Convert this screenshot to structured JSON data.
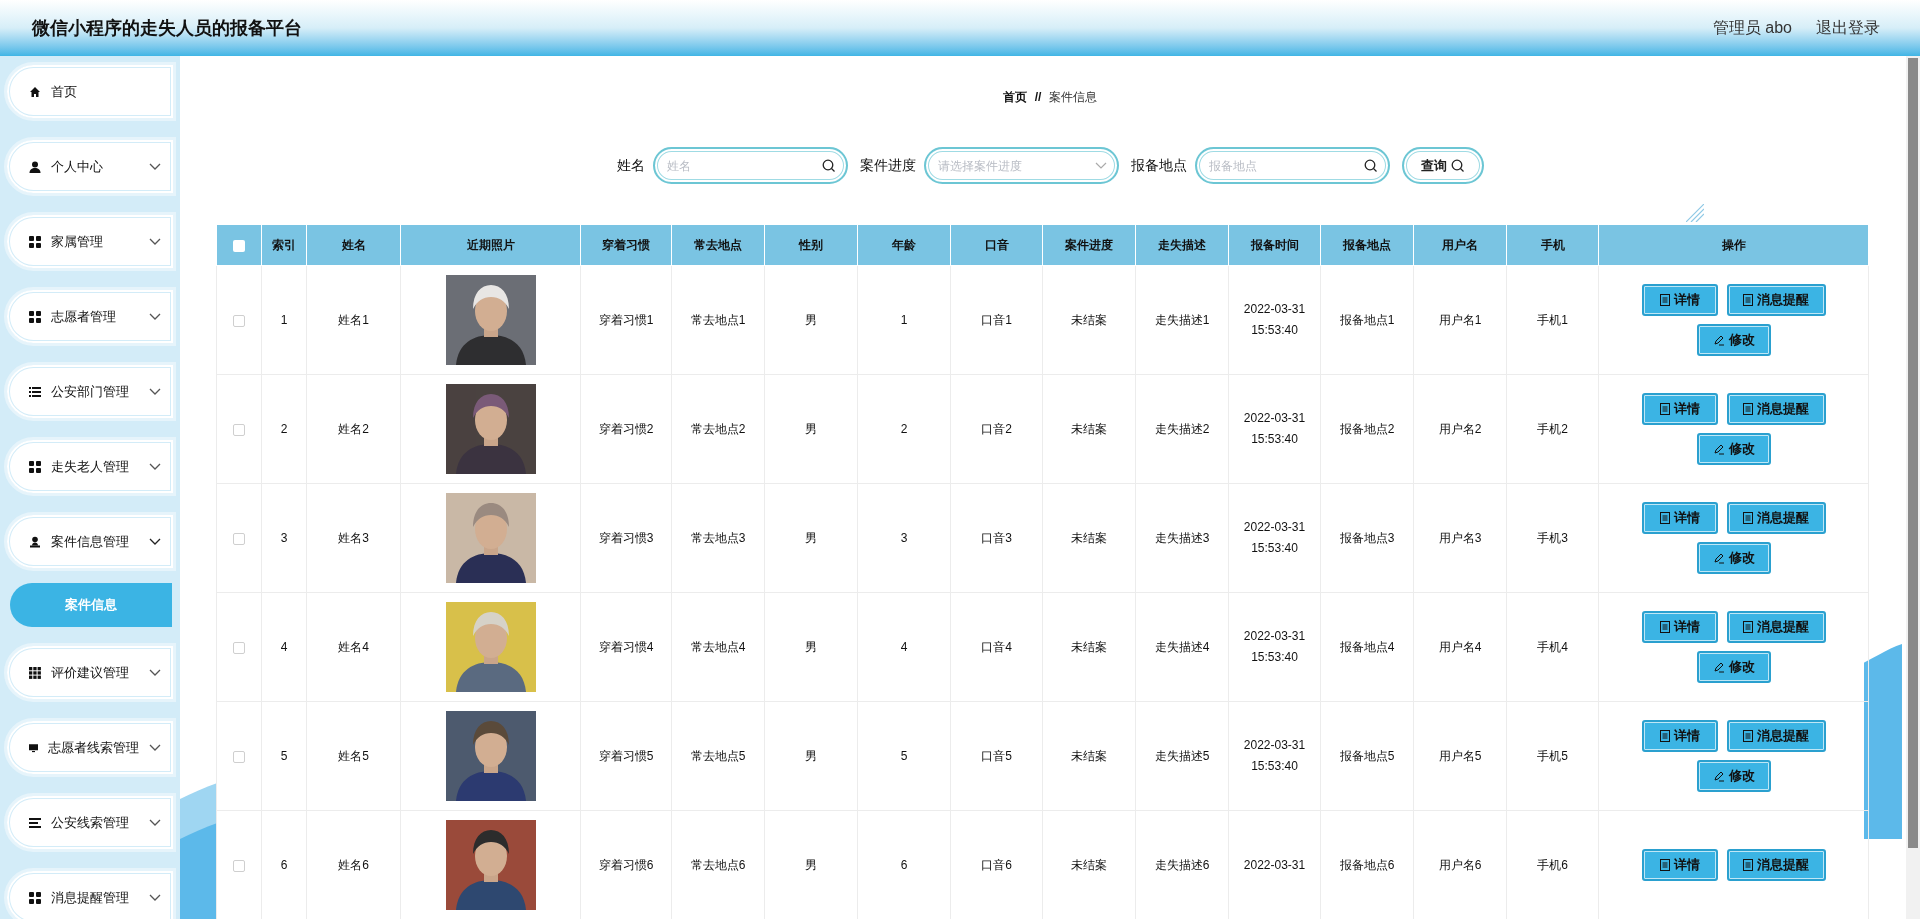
{
  "header": {
    "title": "微信小程序的走失人员的报备平台",
    "user": "管理员 abo",
    "logout": "退出登录"
  },
  "sidebar": {
    "items": [
      {
        "label": "首页"
      },
      {
        "label": "个人中心",
        "expanded": false
      },
      {
        "label": "家属管理",
        "expanded": false
      },
      {
        "label": "志愿者管理",
        "expanded": false
      },
      {
        "label": "公安部门管理",
        "expanded": false
      },
      {
        "label": "走失老人管理",
        "expanded": false
      },
      {
        "label": "案件信息管理",
        "expanded": true,
        "children": [
          {
            "label": "案件信息",
            "selected": true
          }
        ]
      },
      {
        "label": "评价建议管理",
        "expanded": false
      },
      {
        "label": "志愿者线索管理",
        "expanded": false
      },
      {
        "label": "公安线索管理",
        "expanded": false
      },
      {
        "label": "消息提醒管理",
        "expanded": false
      }
    ]
  },
  "breadcrumb": [
    "首页",
    "//",
    "案件信息"
  ],
  "search": {
    "fields": [
      {
        "kind": "text",
        "label": "姓名",
        "placeholder": "姓名"
      },
      {
        "kind": "select",
        "label": "案件进度",
        "placeholder": "请选择案件进度"
      },
      {
        "kind": "text",
        "label": "报备地点",
        "placeholder": "报备地点"
      }
    ],
    "button": "查询"
  },
  "table": {
    "select_all_checked": false,
    "columns": [
      "索引",
      "姓名",
      "近期照片",
      "穿着习惯",
      "常去地点",
      "性别",
      "年龄",
      "口音",
      "案件进度",
      "走失描述",
      "报备时间",
      "报备地点",
      "用户名",
      "手机",
      "操作"
    ],
    "rows": [
      {
        "checked": false,
        "cells": [
          "1",
          "姓名1",
          "",
          "穿着习惯1",
          "常去地点1",
          "男",
          "1",
          "口音1",
          "未结案",
          "走失描述1",
          [
            "2022-03-31",
            "15:53:40"
          ],
          "报备地点1",
          "用户名1",
          "手机1"
        ],
        "actions": [
          "详情",
          "消息提醒",
          "修改"
        ]
      },
      {
        "checked": false,
        "cells": [
          "2",
          "姓名2",
          "",
          "穿着习惯2",
          "常去地点2",
          "男",
          "2",
          "口音2",
          "未结案",
          "走失描述2",
          [
            "2022-03-31",
            "15:53:40"
          ],
          "报备地点2",
          "用户名2",
          "手机2"
        ],
        "actions": [
          "详情",
          "消息提醒",
          "修改"
        ]
      },
      {
        "checked": false,
        "cells": [
          "3",
          "姓名3",
          "",
          "穿着习惯3",
          "常去地点3",
          "男",
          "3",
          "口音3",
          "未结案",
          "走失描述3",
          [
            "2022-03-31",
            "15:53:40"
          ],
          "报备地点3",
          "用户名3",
          "手机3"
        ],
        "actions": [
          "详情",
          "消息提醒",
          "修改"
        ]
      },
      {
        "checked": false,
        "cells": [
          "4",
          "姓名4",
          "",
          "穿着习惯4",
          "常去地点4",
          "男",
          "4",
          "口音4",
          "未结案",
          "走失描述4",
          [
            "2022-03-31",
            "15:53:40"
          ],
          "报备地点4",
          "用户名4",
          "手机4"
        ],
        "actions": [
          "详情",
          "消息提醒",
          "修改"
        ]
      },
      {
        "checked": false,
        "cells": [
          "5",
          "姓名5",
          "",
          "穿着习惯5",
          "常去地点5",
          "男",
          "5",
          "口音5",
          "未结案",
          "走失描述5",
          [
            "2022-03-31",
            "15:53:40"
          ],
          "报备地点5",
          "用户名5",
          "手机5"
        ],
        "actions": [
          "详情",
          "消息提醒",
          "修改"
        ]
      },
      {
        "checked": false,
        "cells": [
          "6",
          "姓名6",
          "",
          "穿着习惯6",
          "常去地点6",
          "男",
          "6",
          "口音6",
          "未结案",
          "走失描述6",
          [
            "2022-03-31"
          ],
          "报备地点6",
          "用户名6",
          "手机6"
        ],
        "actions": [
          "详情",
          "消息提醒"
        ]
      }
    ]
  }
}
